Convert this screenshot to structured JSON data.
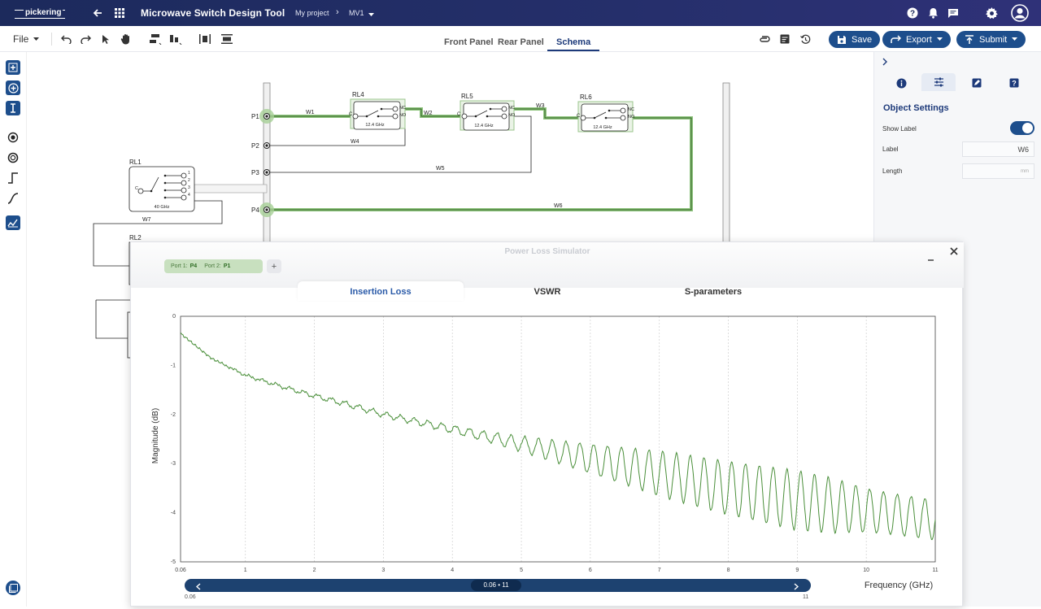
{
  "app": {
    "logo_text": "pickering",
    "title": "Microwave Switch Design Tool"
  },
  "breadcrumb": {
    "project": "My project",
    "separator": "›",
    "variant": "MV1"
  },
  "toolbar": {
    "file_label": "File",
    "tabs": [
      "Front Panel",
      "Rear Panel",
      "Schema"
    ],
    "active_tab": "Schema",
    "save_label": "Save",
    "export_label": "Export",
    "submit_label": "Submit"
  },
  "schema": {
    "ports": [
      "P1",
      "P2",
      "P3",
      "P4"
    ],
    "relays": [
      "RL1",
      "RL2",
      "RL4",
      "RL5",
      "RL6"
    ],
    "relay_freq": "12.4 GHz",
    "rl1_freq": "40 GHz",
    "wires": [
      "W1",
      "W2",
      "W3",
      "W4",
      "W5",
      "W6",
      "W7"
    ],
    "contact_nc": "NC",
    "contact_no": "NO",
    "contact_c": "C",
    "rl1_contacts": [
      "1",
      "2",
      "3",
      "4"
    ]
  },
  "right_panel": {
    "section_title": "Object Settings",
    "show_label": "Show Label",
    "show_label_on": true,
    "label_label": "Label",
    "label_value": "W6",
    "length_label": "Length",
    "length_placeholder": "mm"
  },
  "simulator": {
    "title": "Power Loss Simulator",
    "port1_label": "Port 1:",
    "port1_value": "P4",
    "port2_label": "Port 2:",
    "port2_value": "P1",
    "add_label": "+",
    "tabs": [
      "Insertion Loss",
      "VSWR",
      "S-parameters"
    ],
    "active_tab": "Insertion Loss",
    "range_label": "0.06 • 11",
    "range_min": "0.06",
    "range_max": "11"
  },
  "chart_data": {
    "type": "line",
    "title": "",
    "xlabel": "Frequency (GHz)",
    "ylabel": "Magnitude (dB)",
    "xlim": [
      0.06,
      11
    ],
    "ylim": [
      -5,
      0
    ],
    "x_ticks": [
      "0.06",
      "1",
      "2",
      "3",
      "4",
      "5",
      "6",
      "7",
      "8",
      "9",
      "10",
      "11"
    ],
    "y_ticks": [
      "0",
      "-1",
      "-2",
      "-3",
      "-4",
      "-5"
    ],
    "grid": "vertical dashed",
    "series": [
      {
        "color": "#4a8f3a",
        "x": [
          0.06,
          0.5,
          1,
          1.5,
          2,
          2.5,
          3,
          3.5,
          4,
          4.5,
          5,
          5.5,
          6,
          6.5,
          7,
          7.5,
          8,
          8.5,
          9,
          9.5,
          10,
          10.5,
          11
        ],
        "y_trend": [
          -0.35,
          -0.85,
          -1.2,
          -1.42,
          -1.62,
          -1.8,
          -2.0,
          -2.15,
          -2.3,
          -2.45,
          -2.6,
          -2.75,
          -2.9,
          -3.05,
          -3.2,
          -3.35,
          -3.5,
          -3.62,
          -3.75,
          -3.85,
          -3.95,
          -4.05,
          -4.15
        ],
        "ripple_amplitude_db": [
          0,
          0,
          0.02,
          0.03,
          0.04,
          0.05,
          0.05,
          0.06,
          0.08,
          0.1,
          0.15,
          0.22,
          0.3,
          0.38,
          0.45,
          0.5,
          0.55,
          0.58,
          0.6,
          0.55,
          0.45,
          0.42,
          0.4
        ],
        "ripple_period_ghz": 0.2
      }
    ]
  }
}
